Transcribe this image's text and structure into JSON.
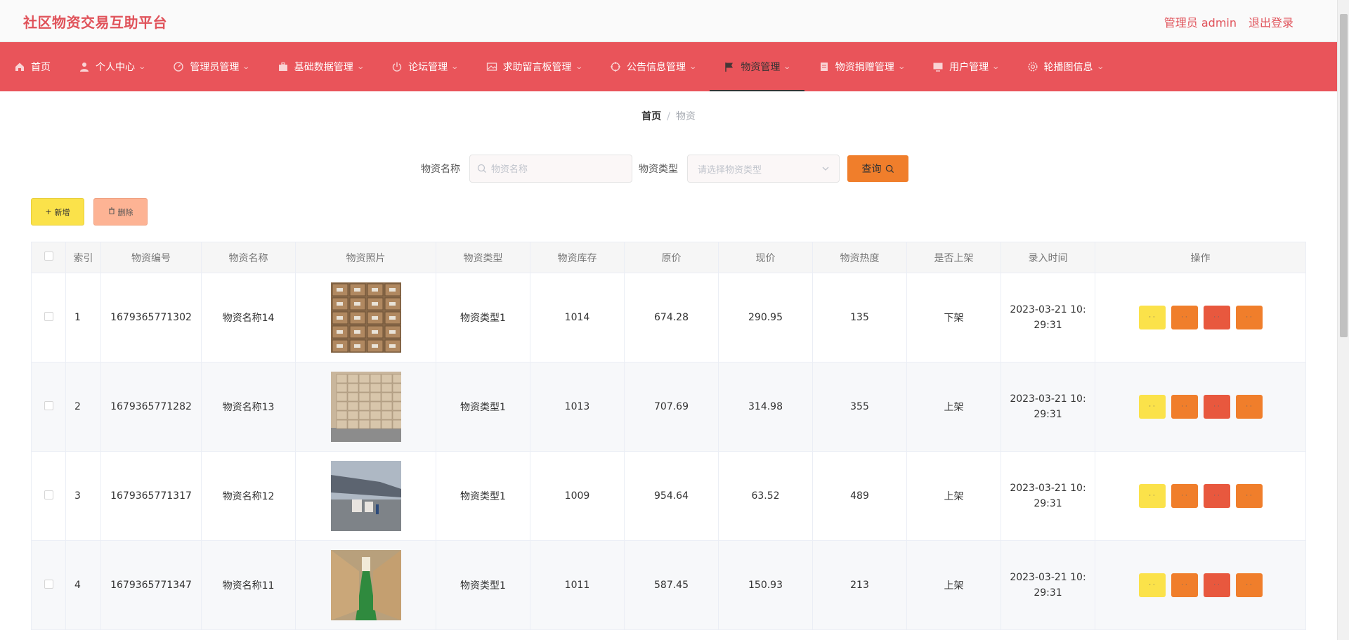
{
  "header": {
    "title": "社区物资交易互助平台",
    "user_label": "管理员 admin",
    "logout_label": "退出登录"
  },
  "nav": [
    {
      "label": "首页",
      "icon": "home-icon",
      "has_caret": false
    },
    {
      "label": "个人中心",
      "icon": "user-icon",
      "has_caret": true
    },
    {
      "label": "管理员管理",
      "icon": "dashboard-icon",
      "has_caret": true
    },
    {
      "label": "基础数据管理",
      "icon": "suitcase-icon",
      "has_caret": true
    },
    {
      "label": "论坛管理",
      "icon": "power-icon",
      "has_caret": true
    },
    {
      "label": "求助留言板管理",
      "icon": "picture-icon",
      "has_caret": true
    },
    {
      "label": "公告信息管理",
      "icon": "aim-icon",
      "has_caret": true
    },
    {
      "label": "物资管理",
      "icon": "flag-icon",
      "has_caret": true,
      "active": true
    },
    {
      "label": "物资捐赠管理",
      "icon": "document-icon",
      "has_caret": true
    },
    {
      "label": "用户管理",
      "icon": "monitor-icon",
      "has_caret": true
    },
    {
      "label": "轮播图信息",
      "icon": "gear-icon",
      "has_caret": true
    }
  ],
  "breadcrumb": {
    "home": "首页",
    "separator": "/",
    "current": "物资"
  },
  "search": {
    "name_label": "物资名称",
    "name_placeholder": "物资名称",
    "type_label": "物资类型",
    "type_placeholder": "请选择物资类型",
    "query_label": "查询"
  },
  "actions": {
    "add_label": "新增",
    "delete_label": "删除"
  },
  "table": {
    "columns": [
      "",
      "索引",
      "物资编号",
      "物资名称",
      "物资照片",
      "物资类型",
      "物资库存",
      "原价",
      "现价",
      "物资热度",
      "是否上架",
      "录入时间",
      "操作"
    ],
    "rows": [
      {
        "index": "1",
        "code": "1679365771302",
        "name": "物资名称14",
        "photo": "boxes-stacked",
        "type": "物资类型1",
        "stock": "1014",
        "orig_price": "674.28",
        "price": "290.95",
        "heat": "135",
        "listed": "下架",
        "time": "2023-03-21 10:29:31"
      },
      {
        "index": "2",
        "code": "1679365771282",
        "name": "物资名称13",
        "photo": "carton-wall",
        "type": "物资类型1",
        "stock": "1013",
        "orig_price": "707.69",
        "price": "314.98",
        "heat": "355",
        "listed": "上架",
        "time": "2023-03-21 10:29:31"
      },
      {
        "index": "3",
        "code": "1679365771317",
        "name": "物资名称12",
        "photo": "cargo-plane",
        "type": "物资类型1",
        "stock": "1009",
        "orig_price": "954.64",
        "price": "63.52",
        "heat": "489",
        "listed": "上架",
        "time": "2023-03-21 10:29:31"
      },
      {
        "index": "4",
        "code": "1679365771347",
        "name": "物资名称11",
        "photo": "warehouse-aisle",
        "type": "物资类型1",
        "stock": "1011",
        "orig_price": "587.45",
        "price": "150.93",
        "heat": "213",
        "listed": "上架",
        "time": "2023-03-21 10:29:31"
      }
    ],
    "op_buttons": [
      "· ·",
      "· ·",
      "· ·",
      "· ·"
    ]
  },
  "colors": {
    "brand": "#e9545a",
    "accent_orange": "#f07e2b",
    "yellow": "#fbe24a",
    "red": "#e8583e",
    "peach": "#fdb394"
  }
}
